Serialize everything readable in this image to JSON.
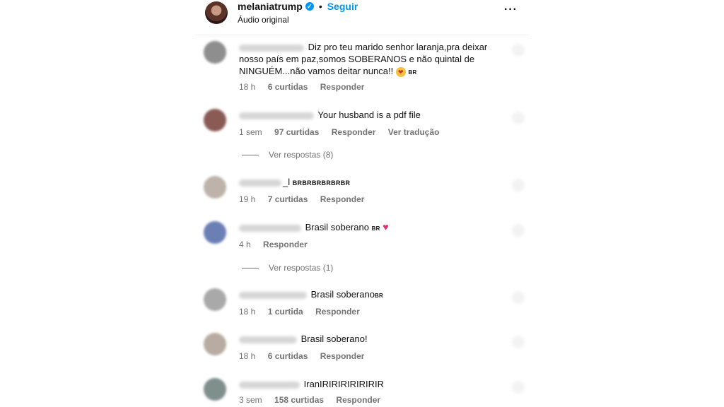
{
  "post": {
    "username": "melaniatrump",
    "follow_label": "Seguir",
    "audio_label": "Áudio original",
    "dot": "•",
    "more_icon": "more-horizontal-icon"
  },
  "comments": [
    {
      "text": "Diz pro teu marido senhor laranja,pra deixar nosso país em paz,somos SOBERANOS e não quintal de NINGUÉM...não vamos deitar nunca!!",
      "flag": "BR",
      "time": "18 h",
      "likes": "6 curtidas",
      "reply": "Responder"
    },
    {
      "text": "Your husband is a pdf file",
      "time": "1 sem",
      "likes": "97 curtidas",
      "reply": "Responder",
      "translate": "Ver tradução",
      "view_replies": "Ver respostas (8)"
    },
    {
      "user_fragment": "_l",
      "text": "BRBRBRBRBRBR",
      "time": "19 h",
      "likes": "7 curtidas",
      "reply": "Responder"
    },
    {
      "text": "Brasil soberano",
      "flag": "BR",
      "time": "4 h",
      "reply": "Responder",
      "view_replies": "Ver respostas (1)"
    },
    {
      "text": "Brasil soberano",
      "flag": "BR",
      "time": "18 h",
      "likes": "1 curtida",
      "reply": "Responder"
    },
    {
      "text": "Brasil soberano!",
      "time": "18 h",
      "likes": "6 curtidas",
      "reply": "Responder"
    },
    {
      "text": "IranIRIRIRIRIRIRIR",
      "time": "3 sem",
      "likes": "158 curtidas",
      "reply": "Responder"
    }
  ],
  "colors": {
    "accent": "#0095f6",
    "meta": "#737373",
    "heart": "#e1306c"
  }
}
